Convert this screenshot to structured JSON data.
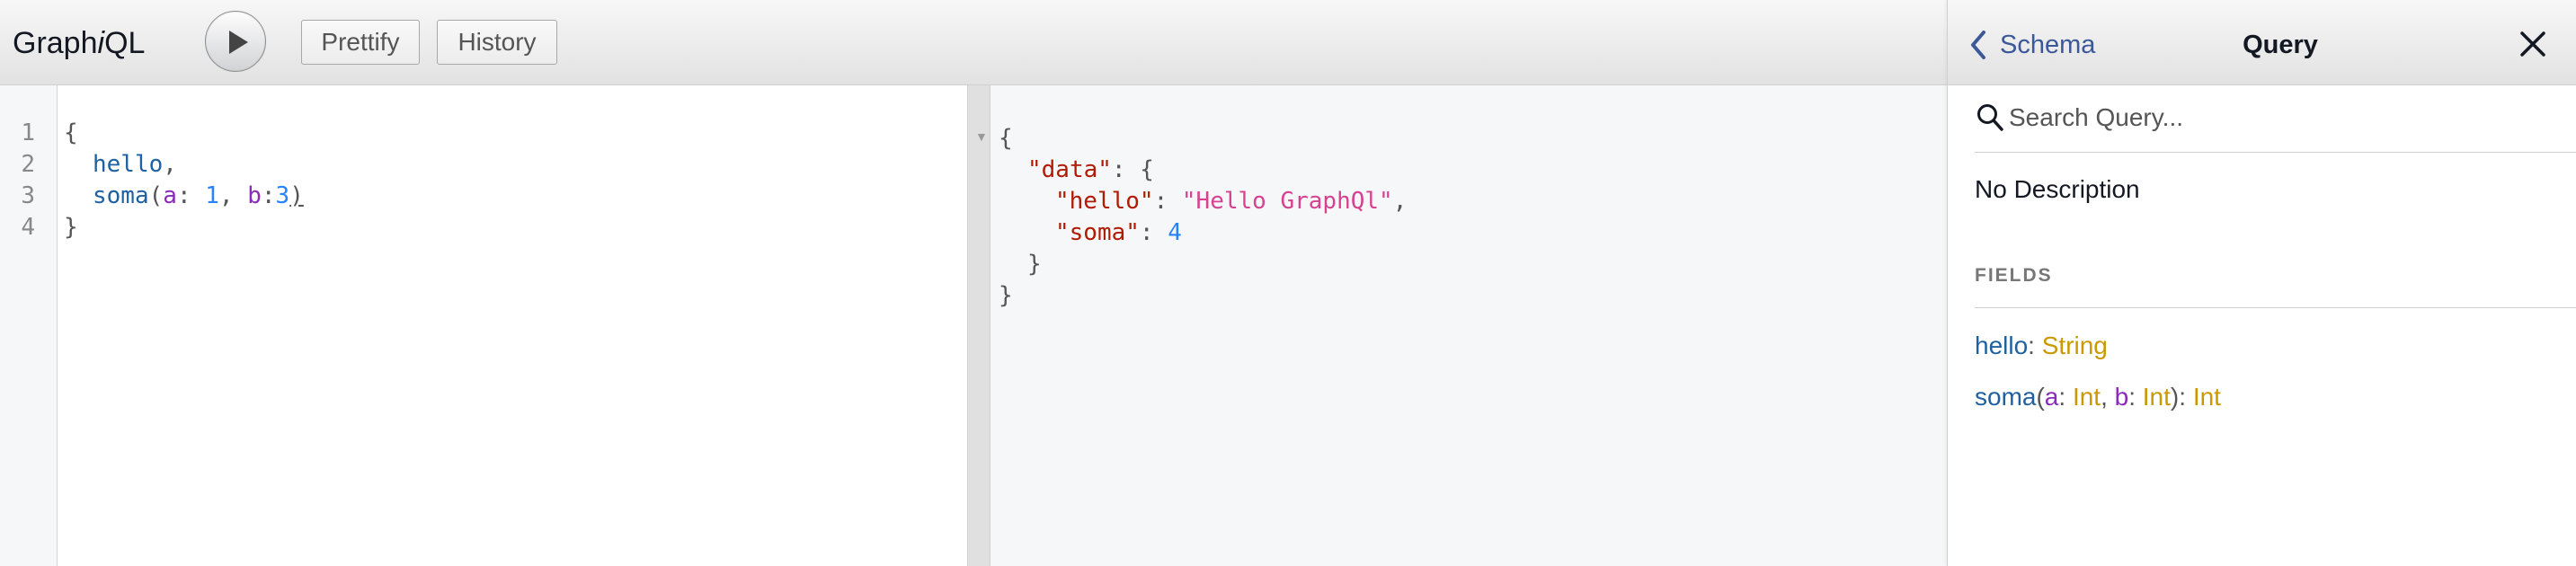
{
  "toolbar": {
    "title_main": "Graph",
    "title_em": "i",
    "title_end": "QL",
    "prettify_label": "Prettify",
    "history_label": "History"
  },
  "query_editor": {
    "line_numbers": [
      "1",
      "2",
      "3",
      "4"
    ],
    "lines": {
      "l1": "{",
      "l2_field": "hello",
      "l2_punc": ",",
      "l3_field": "soma",
      "l3_open": "(",
      "l3_arg1": "a",
      "l3_colon1": ": ",
      "l3_val1": "1",
      "l3_comma": ", ",
      "l3_arg2": "b",
      "l3_colon2": ":",
      "l3_val2": "3",
      "l3_close": ")",
      "l4": "}"
    }
  },
  "result": {
    "fold_marker": "▼",
    "r1": "{",
    "r2_key": "\"data\"",
    "r2_rest": ": {",
    "r3_key": "\"hello\"",
    "r3_colon": ": ",
    "r3_val": "\"Hello GraphQl\"",
    "r3_comma": ",",
    "r4_key": "\"soma\"",
    "r4_colon": ": ",
    "r4_val": "4",
    "r5": "}",
    "r6": "}"
  },
  "doc_explorer": {
    "back_label": "Schema",
    "title": "Query",
    "search_placeholder": "Search Query...",
    "description": "No Description",
    "fields_heading": "FIELDS",
    "fields": [
      {
        "name": "hello",
        "sep": ": ",
        "type": "String"
      },
      {
        "name": "soma",
        "open": "(",
        "arg1": "a",
        "arg1_sep": ": ",
        "arg1_type": "Int",
        "comma": ", ",
        "arg2": "b",
        "arg2_sep": ": ",
        "arg2_type": "Int",
        "close": "): ",
        "type": "Int"
      }
    ]
  },
  "colors": {
    "field": "#1f61a0",
    "argument": "#8b2bb9",
    "number": "#2882f9",
    "json_key": "#b11a04",
    "json_string": "#d64292",
    "type": "#ca9800",
    "link": "#3b5998"
  },
  "icons": {
    "execute": "play-icon",
    "back": "chevron-left-icon",
    "close": "close-icon",
    "search": "search-icon"
  }
}
